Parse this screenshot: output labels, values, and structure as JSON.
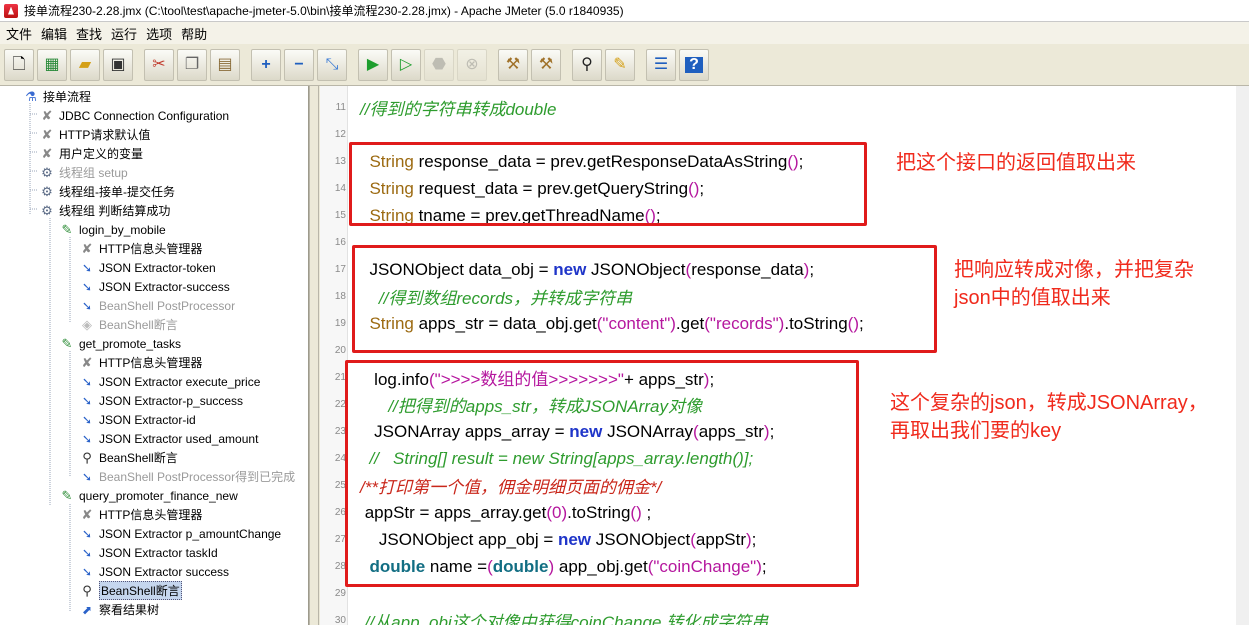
{
  "window": {
    "title": "接单流程230-2.28.jmx (C:\\tool\\test\\apache-jmeter-5.0\\bin\\接单流程230-2.28.jmx) - Apache JMeter (5.0 r1840935)"
  },
  "menu": {
    "items": [
      "文件",
      "编辑",
      "查找",
      "运行",
      "选项",
      "帮助"
    ]
  },
  "toolbar": {
    "buttons": [
      "new",
      "templates",
      "open",
      "save",
      "cut",
      "copy",
      "paste",
      "expand",
      "collapse",
      "toggle",
      "start",
      "start-no-pauses",
      "stop",
      "shutdown",
      "clear",
      "clear-all",
      "search",
      "reset-search",
      "function-helper",
      "help"
    ]
  },
  "tree": {
    "nodes": [
      {
        "label": "接单流程",
        "icon": "test-plan-icon",
        "disabled": false
      },
      {
        "label": "JDBC Connection Configuration",
        "icon": "wrench-icon",
        "disabled": false
      },
      {
        "label": "HTTP请求默认值",
        "icon": "wrench-icon",
        "disabled": false
      },
      {
        "label": "用户定义的变量",
        "icon": "wrench-icon",
        "disabled": false
      },
      {
        "label": "线程组 setup",
        "icon": "thread-group-icon",
        "disabled": true
      },
      {
        "label": "线程组-接单-提交任务",
        "icon": "thread-group-icon",
        "disabled": false
      },
      {
        "label": "线程组 判断结算成功",
        "icon": "thread-group-icon",
        "disabled": false
      },
      {
        "label": "login_by_mobile",
        "icon": "sampler-icon",
        "disabled": false
      },
      {
        "label": "HTTP信息头管理器",
        "icon": "wrench-icon",
        "disabled": false
      },
      {
        "label": "JSON Extractor-token",
        "icon": "json-extractor-icon",
        "disabled": false
      },
      {
        "label": "JSON Extractor-success",
        "icon": "json-extractor-icon",
        "disabled": false
      },
      {
        "label": "BeanShell PostProcessor",
        "icon": "json-extractor-icon",
        "disabled": true
      },
      {
        "label": "BeanShell断言",
        "icon": "assertion-icon",
        "disabled": true
      },
      {
        "label": "get_promote_tasks",
        "icon": "sampler-icon",
        "disabled": false
      },
      {
        "label": "HTTP信息头管理器",
        "icon": "wrench-icon",
        "disabled": false
      },
      {
        "label": "JSON Extractor execute_price",
        "icon": "json-extractor-icon",
        "disabled": false
      },
      {
        "label": "JSON Extractor-p_success",
        "icon": "json-extractor-icon",
        "disabled": false
      },
      {
        "label": "JSON Extractor-id",
        "icon": "json-extractor-icon",
        "disabled": false
      },
      {
        "label": "JSON Extractor used_amount",
        "icon": "json-extractor-icon",
        "disabled": false
      },
      {
        "label": "BeanShell断言",
        "icon": "magnifier-icon",
        "disabled": false
      },
      {
        "label": "BeanShell PostProcessor得到已完成",
        "icon": "json-extractor-icon",
        "disabled": true
      },
      {
        "label": "query_promoter_finance_new",
        "icon": "sampler-icon",
        "disabled": false
      },
      {
        "label": "HTTP信息头管理器",
        "icon": "wrench-icon",
        "disabled": false
      },
      {
        "label": "JSON Extractor p_amountChange",
        "icon": "json-extractor-icon",
        "disabled": false
      },
      {
        "label": "JSON Extractor taskId",
        "icon": "json-extractor-icon",
        "disabled": false
      },
      {
        "label": "JSON Extractor success",
        "icon": "json-extractor-icon",
        "disabled": false
      },
      {
        "label": "BeanShell断言",
        "icon": "magnifier-icon",
        "disabled": false,
        "selected": true
      },
      {
        "label": "察看结果树",
        "icon": "listener-icon",
        "disabled": false
      }
    ]
  },
  "editor": {
    "lines": [
      {
        "n": "11",
        "segments": [
          {
            "t": "//得到的字符串转成double",
            "c": "cm"
          }
        ]
      },
      {
        "n": "12",
        "segments": []
      },
      {
        "n": "13",
        "segments": [
          {
            "t": "  String",
            "c": "kw"
          },
          {
            "t": " response_data = prev.getResponseDataAsString",
            "c": ""
          },
          {
            "t": "()",
            "c": "str"
          },
          {
            "t": ";",
            "c": ""
          }
        ]
      },
      {
        "n": "14",
        "segments": [
          {
            "t": "  String",
            "c": "kw"
          },
          {
            "t": " request_data = prev.getQueryString",
            "c": ""
          },
          {
            "t": "()",
            "c": "str"
          },
          {
            "t": ";",
            "c": ""
          }
        ]
      },
      {
        "n": "15",
        "segments": [
          {
            "t": "  String",
            "c": "kw"
          },
          {
            "t": " tname = prev.getThreadName",
            "c": ""
          },
          {
            "t": "()",
            "c": "str"
          },
          {
            "t": ";",
            "c": ""
          }
        ]
      },
      {
        "n": "16",
        "segments": []
      },
      {
        "n": "17",
        "segments": [
          {
            "t": "  JSONObject data_obj = ",
            "c": ""
          },
          {
            "t": "new",
            "c": "kw2"
          },
          {
            "t": " JSONObject",
            "c": ""
          },
          {
            "t": "(",
            "c": "str"
          },
          {
            "t": "response_data",
            "c": ""
          },
          {
            "t": ")",
            "c": "str"
          },
          {
            "t": ";",
            "c": ""
          }
        ]
      },
      {
        "n": "18",
        "segments": [
          {
            "t": "    //得到数组records，并转成字符串",
            "c": "cm"
          }
        ]
      },
      {
        "n": "19",
        "segments": [
          {
            "t": "  String",
            "c": "kw"
          },
          {
            "t": " apps_str = data_obj.get",
            "c": ""
          },
          {
            "t": "(\"content\")",
            "c": "str"
          },
          {
            "t": ".get",
            "c": ""
          },
          {
            "t": "(\"records\")",
            "c": "str"
          },
          {
            "t": ".toString",
            "c": ""
          },
          {
            "t": "()",
            "c": "str"
          },
          {
            "t": ";",
            "c": ""
          }
        ]
      },
      {
        "n": "20",
        "segments": []
      },
      {
        "n": "21",
        "segments": [
          {
            "t": "   log.info",
            "c": ""
          },
          {
            "t": "(\">>>>数组的值>>>>>>>\"",
            "c": "str"
          },
          {
            "t": "+ apps_str",
            "c": ""
          },
          {
            "t": ")",
            "c": "str"
          },
          {
            "t": ";",
            "c": ""
          }
        ]
      },
      {
        "n": "22",
        "segments": [
          {
            "t": "      //把得到的apps_str，转成JSONArray对像",
            "c": "cm"
          }
        ]
      },
      {
        "n": "23",
        "segments": [
          {
            "t": "   JSONArray apps_array = ",
            "c": ""
          },
          {
            "t": "new",
            "c": "kw2"
          },
          {
            "t": " JSONArray",
            "c": ""
          },
          {
            "t": "(",
            "c": "str"
          },
          {
            "t": "apps_str",
            "c": ""
          },
          {
            "t": ")",
            "c": "str"
          },
          {
            "t": ";",
            "c": ""
          }
        ]
      },
      {
        "n": "24",
        "segments": [
          {
            "t": "  //   String[] result = new String[apps_array.length()];",
            "c": "cm"
          }
        ]
      },
      {
        "n": "25",
        "segments": [
          {
            "t": "/**打印第一个值，佣金明细页面的佣金*/",
            "c": "cm2"
          }
        ]
      },
      {
        "n": "26",
        "segments": [
          {
            "t": " appStr = apps_array.get",
            "c": ""
          },
          {
            "t": "(0)",
            "c": "str"
          },
          {
            "t": ".toString",
            "c": ""
          },
          {
            "t": "()",
            "c": "str"
          },
          {
            "t": " ;",
            "c": ""
          }
        ]
      },
      {
        "n": "27",
        "segments": [
          {
            "t": "    JSONObject app_obj = ",
            "c": ""
          },
          {
            "t": "new",
            "c": "kw2"
          },
          {
            "t": " JSONObject",
            "c": ""
          },
          {
            "t": "(",
            "c": "str"
          },
          {
            "t": "appStr",
            "c": ""
          },
          {
            "t": ")",
            "c": "str"
          },
          {
            "t": ";",
            "c": ""
          }
        ]
      },
      {
        "n": "28",
        "segments": [
          {
            "t": "  double",
            "c": "kw3"
          },
          {
            "t": " name =",
            "c": ""
          },
          {
            "t": "(",
            "c": "str"
          },
          {
            "t": "double",
            "c": "kw3"
          },
          {
            "t": ")",
            "c": "str"
          },
          {
            "t": " app_obj.get",
            "c": ""
          },
          {
            "t": "(\"coinChange\")",
            "c": "str"
          },
          {
            "t": ";",
            "c": ""
          }
        ]
      },
      {
        "n": "29",
        "segments": []
      },
      {
        "n": "30",
        "segments": [
          {
            "t": " //从app_obj这个对像中获得coinChange,转化成字符串",
            "c": "cm"
          }
        ]
      }
    ]
  },
  "annotations": {
    "a1": "把这个接口的返回值取出来",
    "a2_line1": "把响应转成对像，并把复杂",
    "a2_line2": "json中的值取出来",
    "a3_line1": "这个复杂的json，转成JSONArray，",
    "a3_line2": "再取出我们要的key"
  },
  "colors": {
    "annotation": "#f02a1c",
    "box": "#e01b1b",
    "comment": "#2e9c2e",
    "keyword_new": "#1f35c9",
    "string": "#b5179e"
  }
}
